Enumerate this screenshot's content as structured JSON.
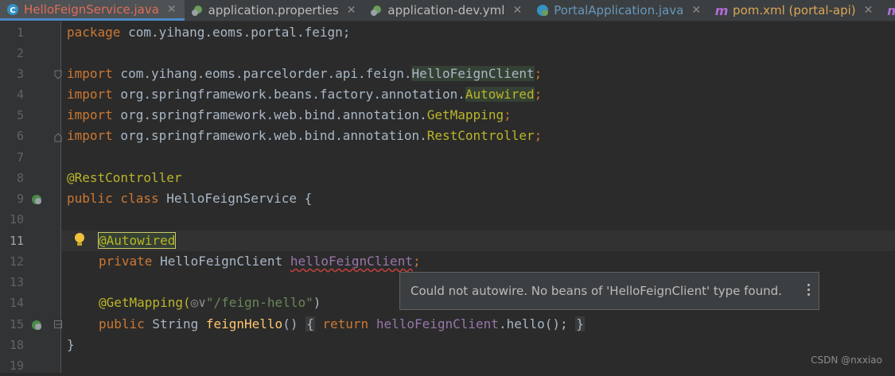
{
  "tabs": [
    {
      "label": "HelloFeignService.java",
      "icon": "java-class-icon",
      "active": true
    },
    {
      "label": "application.properties",
      "icon": "spring-config-icon"
    },
    {
      "label": "application-dev.yml",
      "icon": "spring-config-icon"
    },
    {
      "label": "PortalApplication.java",
      "icon": "spring-boot-class-icon"
    },
    {
      "label": "pom.xml (portal-api)",
      "icon": "maven-icon"
    },
    {
      "label": "m",
      "icon": "maven-icon"
    }
  ],
  "tab_close_glyph": "✕",
  "line_numbers": [
    "1",
    "2",
    "3",
    "4",
    "5",
    "6",
    "7",
    "8",
    "9",
    "10",
    "11",
    "12",
    "13",
    "14",
    "15",
    "18",
    "19"
  ],
  "code": {
    "l1": {
      "kw": "package",
      "rest": " com.yihang.eoms.portal.feign;"
    },
    "l3": {
      "kw": "import",
      "rest": " com.yihang.eoms.parcelorder.api.feign.",
      "cls": "HelloFeignClient",
      "end": ";"
    },
    "l4": {
      "kw": "import",
      "rest": " org.springframework.beans.factory.annotation.",
      "cls": "Autowired",
      "end": ";"
    },
    "l5": {
      "kw": "import",
      "rest": " org.springframework.web.bind.annotation.",
      "cls": "GetMapping",
      "end": ";"
    },
    "l6": {
      "kw": "import",
      "rest": " org.springframework.web.bind.annotation.",
      "cls": "RestController",
      "end": ";"
    },
    "l8": {
      "ann": "@RestController"
    },
    "l9": {
      "kw": "public class",
      "rest": " HelloFeignService {"
    },
    "l11": {
      "ann": "@Autowired"
    },
    "l12": {
      "kw": "private",
      "type": " HelloFeignClient ",
      "field": "helloFeignClient",
      "end": ";"
    },
    "l14": {
      "ann": "@GetMapping(",
      "glyph": "◎∨",
      "str": "\"/feign-hello\"",
      "end": ")"
    },
    "l15": {
      "kw": "public",
      "type": " String ",
      "method": "feignHello",
      "paren": "()",
      "ob": "{",
      "ret": "return",
      "field": "helloFeignClient",
      "call": ".hello();",
      "cb": "}"
    },
    "l18": {
      "text": "}"
    }
  },
  "tooltip": {
    "message": "Could not autowire. No beans of 'HelloFeignClient' type found."
  },
  "watermark": "CSDN @nxxiao",
  "colors": {
    "keyword": "#cc7832",
    "annotation": "#bbb529",
    "string": "#6a8759",
    "field": "#9876aa",
    "text": "#a9b7c6"
  }
}
